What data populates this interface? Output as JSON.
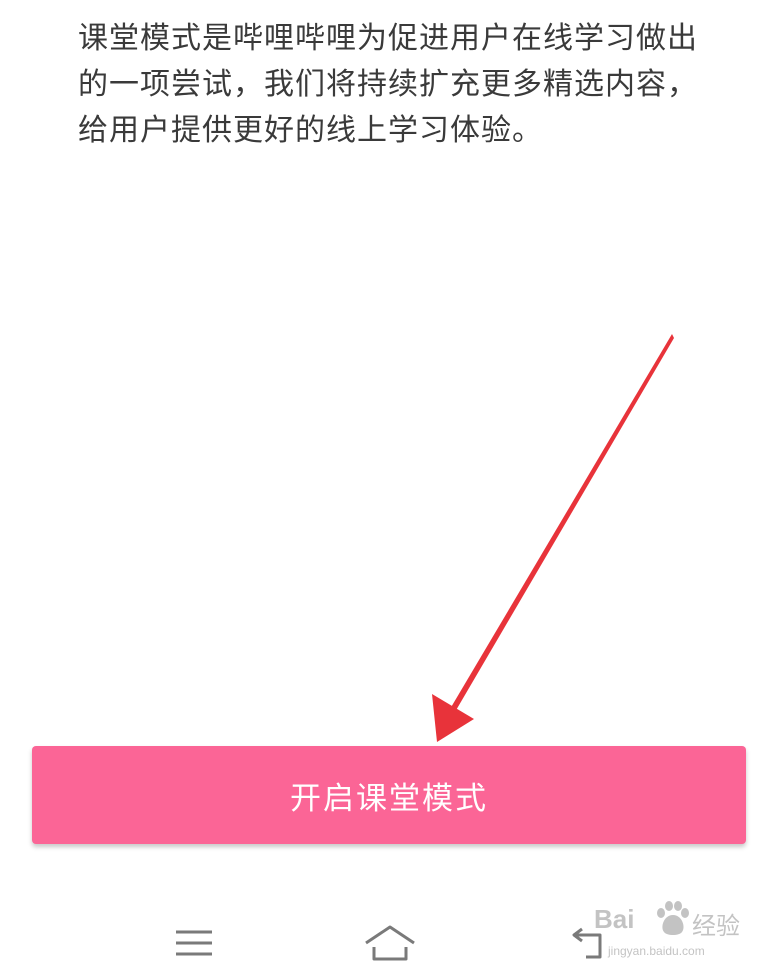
{
  "description": "课堂模式是哔哩哔哩为促进用户在线学习做出的一项尝试，我们将持续扩充更多精选内容，给用户提供更好的线上学习体验。",
  "primary_button": {
    "label": "开启课堂模式"
  },
  "colors": {
    "button_bg": "#fb6596",
    "arrow": "#e8333a",
    "text": "#3a3a3a"
  },
  "nav_bar": {
    "icons": [
      "menu-icon",
      "home-icon",
      "back-icon"
    ]
  },
  "watermark": {
    "brand": "Bai",
    "site": "经验",
    "url": "jingyan.baidu.com"
  }
}
